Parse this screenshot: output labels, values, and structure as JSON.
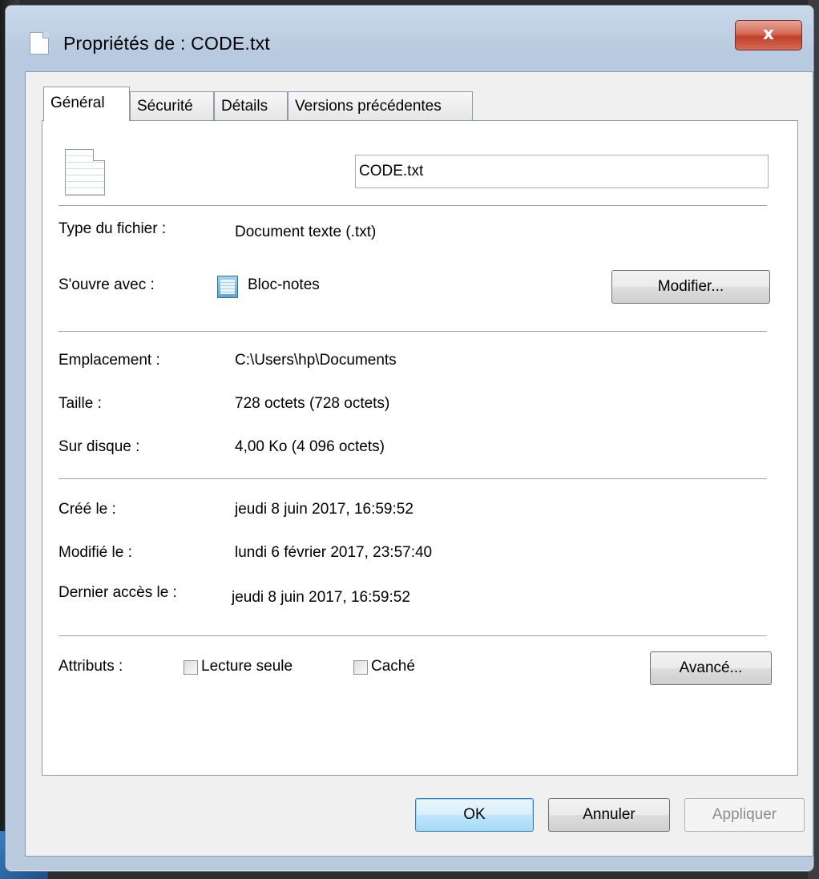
{
  "window": {
    "title": "Propriétés de : CODE.txt",
    "close_glyph": "x"
  },
  "tabs": [
    {
      "label": "Général",
      "active": true
    },
    {
      "label": "Sécurité",
      "active": false
    },
    {
      "label": "Détails",
      "active": false
    },
    {
      "label": "Versions précédentes",
      "active": false
    }
  ],
  "general": {
    "file_name": "CODE.txt",
    "file_icon": "text-file-icon",
    "type_label": "Type du fichier :",
    "type_value": "Document texte (.txt)",
    "opens_with_label": "S'ouvre avec :",
    "opens_with_icon": "notepad-icon",
    "opens_with_value": "Bloc-notes",
    "change_button": "Modifier...",
    "location_label": "Emplacement :",
    "location_value": "C:\\Users\\hp\\Documents",
    "size_label": "Taille :",
    "size_value": "728 octets (728 octets)",
    "on_disk_label": "Sur disque :",
    "on_disk_value": "4,00 Ko (4 096 octets)",
    "created_label": "Créé le :",
    "created_value": "jeudi 8 juin 2017, 16:59:52",
    "modified_label": "Modifié le :",
    "modified_value": "lundi 6 février 2017, 23:57:40",
    "accessed_label": "Dernier accès le :",
    "accessed_value": "jeudi 8 juin 2017, 16:59:52",
    "attributes_label": "Attributs :",
    "readonly_label": "Lecture seule",
    "readonly_checked": false,
    "hidden_label": "Caché",
    "hidden_checked": false,
    "advanced_button": "Avancé..."
  },
  "footer": {
    "ok": "OK",
    "cancel": "Annuler",
    "apply": "Appliquer"
  }
}
